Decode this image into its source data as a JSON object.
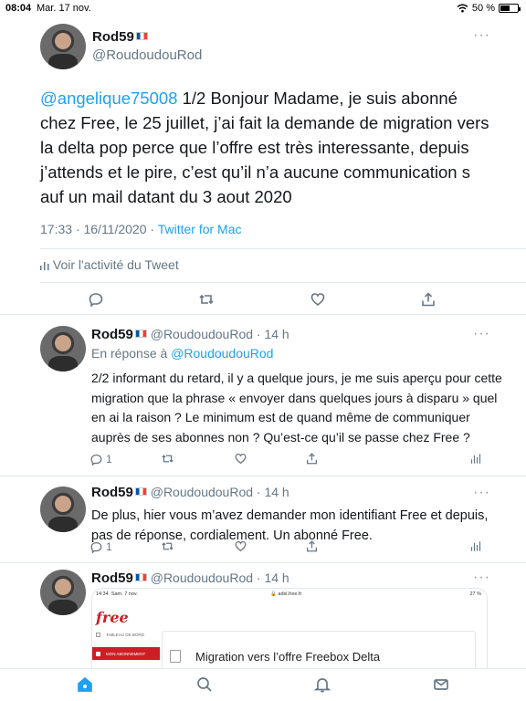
{
  "status_bar": {
    "time": "08:04",
    "date": "Mar. 17 nov.",
    "battery": "50 %",
    "battery_level": 0.5
  },
  "main_tweet": {
    "name": "Rod59",
    "handle": "@RoudoudouRod",
    "mention": "@angelique75008",
    "text": " 1/2 Bonjour Madame, je suis abonné chez Free, le 25 juillet, j’ai fait la demande de migration vers la delta pop perce que l’offre est très interessante, depuis j’attends et le pire, c’est qu’il n’a aucune communication s auf un mail datant du 3 aout 2020",
    "timestamp": "17:33 · 16/11/2020 · ",
    "client": "Twitter for Mac",
    "activity_label": "Voir l'activité du Tweet"
  },
  "replies": [
    {
      "name": "Rod59",
      "handle": "@RoudoudouRod",
      "time": "· 14 h",
      "replying_to_prefix": "En réponse à ",
      "replying_to": "@RoudoudouRod",
      "text": "2/2 informant du retard, il y a quelque jours, je me suis aperçu pour cette migration que la phrase « envoyer dans quelques jours à disparu » quel en ai la raison ? Le minimum est de quand même de communiquer auprès de ses abonnes non ? Qu’est-ce qu’il se passe chez Free ?",
      "reply_count": "1"
    },
    {
      "name": "Rod59",
      "handle": "@RoudoudouRod",
      "time": "· 14 h",
      "text": "De plus, hier vous m’avez demander mon identifiant Free et depuis, pas de réponse, cordialement. Un abonné Free.",
      "reply_count": "1"
    },
    {
      "name": "Rod59",
      "handle": "@RoudoudouRod",
      "time": "· 14 h"
    }
  ],
  "embedded_screenshot": {
    "time": "14:34",
    "date": "Sam. 7 nov.",
    "url": "adsl.free.fr",
    "battery": "27 %",
    "logo": "free",
    "menu_dashboard": "TABLEAU DE BORD",
    "menu_subscription": "MON ABONNEMENT",
    "panel_title": "Migration vers l’offre Freebox Delta"
  },
  "tabbar": [
    "home-icon",
    "search-icon",
    "notifications-icon",
    "messages-icon"
  ],
  "colors": {
    "accent": "#1da1f2",
    "secondary_text": "#657786",
    "free_red": "#cd1e25"
  }
}
